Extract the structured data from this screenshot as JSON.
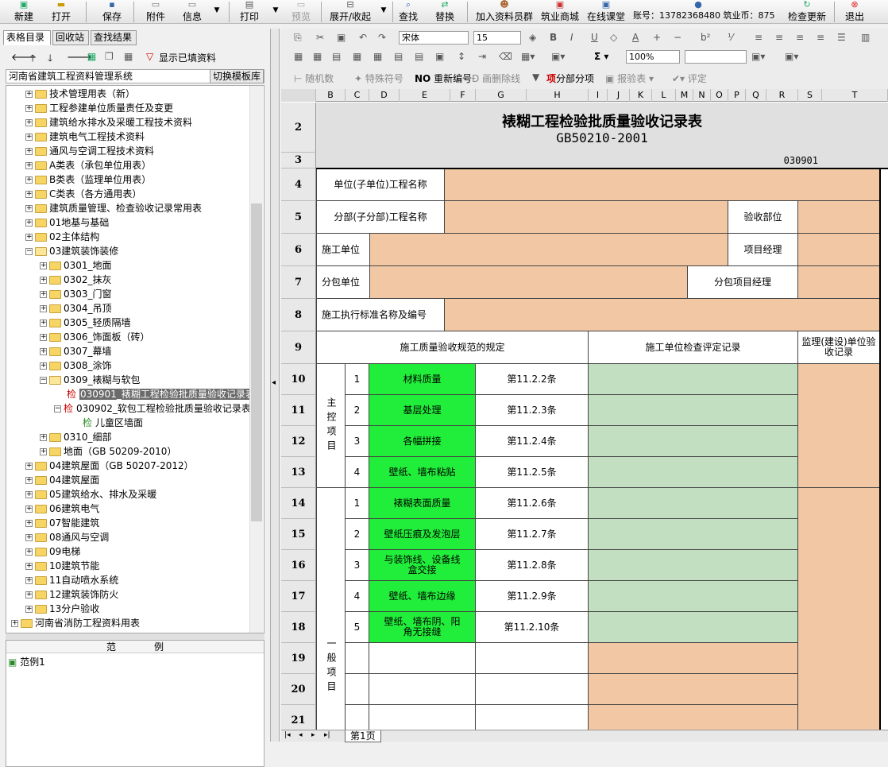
{
  "toolbar": {
    "new": "新建",
    "open": "打开",
    "save": "保存",
    "attach": "附件",
    "info": "信息",
    "print": "打印",
    "preview": "预览",
    "expand": "展开/收起",
    "find": "查找",
    "replace": "替换",
    "join_group": "加入资料员群",
    "mall": "筑业商城",
    "online_class": "在线课堂",
    "account": "账号：13782368480 筑业币：875",
    "check_update": "检查更新",
    "exit": "退出"
  },
  "left": {
    "tabs": [
      "表格目录",
      "回收站",
      "查找结果"
    ],
    "show_filled": "显示已填资料",
    "root_system": "河南省建筑工程资料管理系统",
    "switch_template": "切换模板库",
    "tree": [
      "技术管理用表（新）",
      "工程参建单位质量责任及变更",
      "建筑给水排水及采暖工程技术资料",
      "建筑电气工程技术资料",
      "通风与空调工程技术资料",
      "A类表（承包单位用表）",
      "B类表（监理单位用表）",
      "C类表（各方通用表）",
      "建筑质量管理、检查验收记录常用表",
      "01地基与基础",
      "02主体结构",
      "03建筑装饰装修",
      "0301_地面",
      "0302_抹灰",
      "0303_门窗",
      "0304_吊顶",
      "0305_轻质隔墙",
      "0306_饰面板（砖）",
      "0307_幕墙",
      "0308_涂饰",
      "0309_裱糊与软包",
      "030901_裱糊工程检验批质量验收记录表",
      "030902_软包工程检验批质量验收记录表",
      "儿童区墙面",
      "0310_细部",
      "地面（GB 50209-2010）",
      "04建筑屋面（GB 50207-2012）",
      "04建筑屋面",
      "05建筑给水、排水及采暖",
      "06建筑电气",
      "07智能建筑",
      "08通风与空调",
      "09电梯",
      "10建筑节能",
      "11自动喷水系统",
      "12建筑装饰防火",
      "13分户验收",
      "河南省消防工程资料用表"
    ],
    "check_mark": "检",
    "example_header": "范　　　　例",
    "example_item": "范例1"
  },
  "format": {
    "font": "宋体",
    "size": "15",
    "zoom": "100%",
    "random": "随机数",
    "special": "特殊符号",
    "renumber": "重新编号",
    "strike": "画删除线",
    "subproject": "分部分项",
    "report": "报验表",
    "evaluate": "评定"
  },
  "sheet": {
    "columns": [
      "B",
      "C",
      "D",
      "E",
      "F",
      "G",
      "H",
      "I",
      "J",
      "K",
      "L",
      "M",
      "N",
      "O",
      "P",
      "Q",
      "R",
      "S",
      "T"
    ],
    "rows": [
      "2",
      "3",
      "4",
      "5",
      "6",
      "7",
      "8",
      "9",
      "10",
      "11",
      "12",
      "13",
      "14",
      "15",
      "16",
      "17",
      "18",
      "19",
      "20",
      "21"
    ],
    "title": "裱糊工程检验批质量验收记录表",
    "code": "GB50210-2001",
    "number": "030901",
    "unit_name": "单位(子单位)工程名称",
    "sub_name": "分部(子分部)工程名称",
    "acceptance_part": "验收部位",
    "contractor": "施工单位",
    "pm": "项目经理",
    "subcontractor": "分包单位",
    "sub_pm": "分包项目经理",
    "standard": "施工执行标准名称及编号",
    "spec_header": "施工质量验收规范的规定",
    "check_header": "施工单位检查评定记录",
    "supervisor_header": "监理(建设)单位验收记录",
    "main_group": "主控项目",
    "general_group": "一般项目",
    "main_items": [
      {
        "n": "1",
        "name": "材料质量",
        "clause": "第11.2.2条"
      },
      {
        "n": "2",
        "name": "基层处理",
        "clause": "第11.2.3条"
      },
      {
        "n": "3",
        "name": "各幅拼接",
        "clause": "第11.2.4条"
      },
      {
        "n": "4",
        "name": "壁纸、墙布粘贴",
        "clause": "第11.2.5条"
      }
    ],
    "general_items": [
      {
        "n": "1",
        "name": "裱糊表面质量",
        "clause": "第11.2.6条"
      },
      {
        "n": "2",
        "name": "壁纸压痕及发泡层",
        "clause": "第11.2.7条"
      },
      {
        "n": "3",
        "name": "与装饰线、设备线盒交接",
        "clause": "第11.2.8条"
      },
      {
        "n": "4",
        "name": "壁纸、墙布边缘",
        "clause": "第11.2.9条"
      },
      {
        "n": "5",
        "name": "壁纸、墙布阴、阳角无接缝",
        "clause": "第11.2.10条"
      }
    ],
    "tab": "第1页"
  }
}
